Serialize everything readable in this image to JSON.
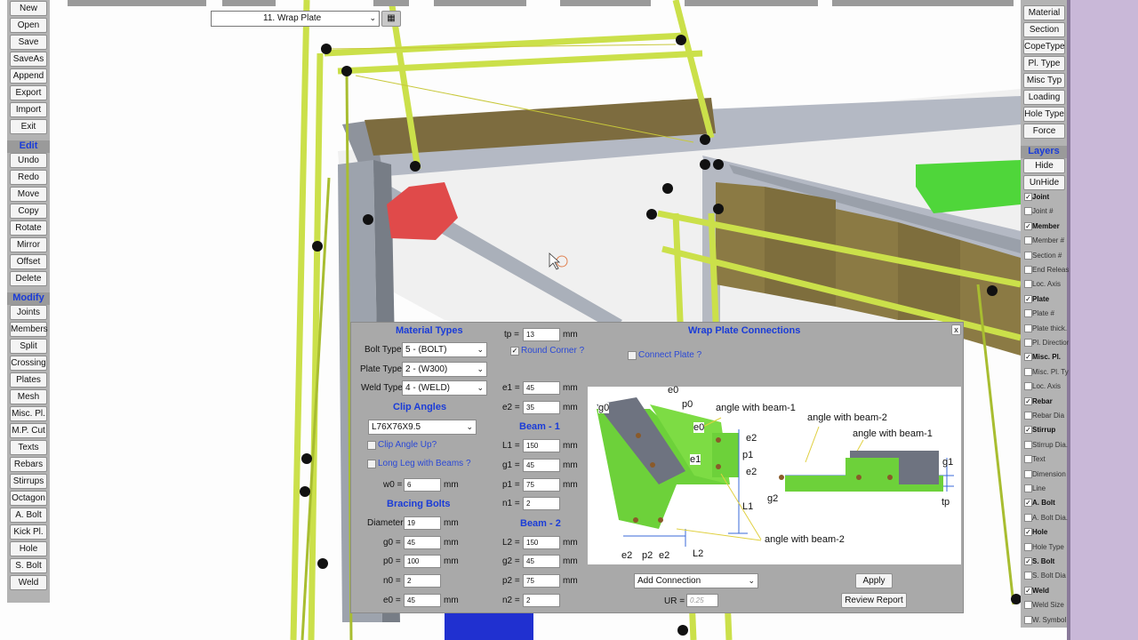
{
  "top": {
    "connection_select": "11. Wrap Plate"
  },
  "file_menu": [
    "New",
    "Open",
    "Save",
    "SaveAs",
    "Append",
    "Export",
    "Import",
    "Exit"
  ],
  "edit": {
    "title": "Edit",
    "items": [
      "Undo",
      "Redo",
      "Move",
      "Copy",
      "Rotate",
      "Mirror",
      "Offset",
      "Delete"
    ]
  },
  "modify": {
    "title": "Modify",
    "items": [
      "Joints",
      "Members",
      "Split",
      "Crossing",
      "Plates",
      "Mesh",
      "Misc. Pl.",
      "M.P. Cut",
      "Texts",
      "Rebars",
      "Stirrups",
      "Octagon",
      "A. Bolt",
      "Kick Pl.",
      "Hole",
      "S. Bolt",
      "Weld"
    ]
  },
  "right_menu": [
    "Material",
    "Section",
    "CopeType",
    "Pl. Type",
    "Misc Typ",
    "Loading",
    "Hole Type",
    "Force"
  ],
  "layers": {
    "title": "Layers",
    "hide": "Hide",
    "unhide": "UnHide",
    "items": [
      {
        "label": "Joint",
        "checked": true
      },
      {
        "label": "Joint #",
        "checked": false
      },
      {
        "label": "Member",
        "checked": true
      },
      {
        "label": "Member #",
        "checked": false
      },
      {
        "label": "Section #",
        "checked": false
      },
      {
        "label": "End Release",
        "checked": false
      },
      {
        "label": "Loc. Axis",
        "checked": false
      },
      {
        "label": "Plate",
        "checked": true
      },
      {
        "label": "Plate #",
        "checked": false
      },
      {
        "label": "Plate thick.",
        "checked": false
      },
      {
        "label": "Pl. Direction",
        "checked": false
      },
      {
        "label": "Misc. Pl.",
        "checked": true
      },
      {
        "label": "Misc. Pl. Type",
        "checked": false
      },
      {
        "label": "Loc. Axis",
        "checked": false
      },
      {
        "label": "Rebar",
        "checked": true
      },
      {
        "label": "Rebar Dia",
        "checked": false
      },
      {
        "label": "Stirrup",
        "checked": true
      },
      {
        "label": "Stirrup Dia.",
        "checked": false
      },
      {
        "label": "Text",
        "checked": false
      },
      {
        "label": "Dimension",
        "checked": false
      },
      {
        "label": "Line",
        "checked": false
      },
      {
        "label": "A. Bolt",
        "checked": true
      },
      {
        "label": "A. Bolt Dia.",
        "checked": false
      },
      {
        "label": "Hole",
        "checked": true
      },
      {
        "label": "Hole Type",
        "checked": false
      },
      {
        "label": "S. Bolt",
        "checked": true
      },
      {
        "label": "S. Bolt Dia",
        "checked": false
      },
      {
        "label": "Weld",
        "checked": true
      },
      {
        "label": "Weld Size",
        "checked": false
      },
      {
        "label": "W. Symbol",
        "checked": false
      }
    ]
  },
  "dialog": {
    "title": "Wrap Plate Connections",
    "close": "x",
    "material_types": "Material Types",
    "bolt_type_label": "Bolt Type",
    "bolt_type": "5 - (BOLT)",
    "plate_type_label": "Plate Type",
    "plate_type": "2 - (W300)",
    "weld_type_label": "Weld Type",
    "weld_type": "4 - (WELD)",
    "clip_angles": "Clip Angles",
    "clip_section": "L76X76X9.5",
    "clip_up": "Clip Angle Up?",
    "long_leg": "Long Leg with Beams ?",
    "w0_label": "w0 =",
    "w0": "6",
    "bracing_bolts": "Bracing Bolts",
    "diameter_label": "Diameter",
    "diameter": "19",
    "g0_label": "g0 =",
    "g0": "45",
    "p0_label": "p0 =",
    "p0": "100",
    "n0_label": "n0 =",
    "n0": "2",
    "e0_label": "e0 =",
    "e0": "45",
    "tp_label": "tp =",
    "tp": "13",
    "round_corner": "Round Corner ?",
    "connect_plate": "Connect Plate ?",
    "e1_label": "e1 =",
    "e1": "45",
    "e2_label": "e2 =",
    "e2": "35",
    "beam1": "Beam - 1",
    "L1_label": "L1 =",
    "L1": "150",
    "g1_label": "g1 =",
    "g1": "45",
    "p1_label": "p1 =",
    "p1": "75",
    "n1_label": "n1 =",
    "n1": "2",
    "beam2": "Beam - 2",
    "L2_label": "L2 =",
    "L2": "150",
    "g2_label": "g2 =",
    "g2": "45",
    "p2_label": "p2 =",
    "p2": "75",
    "n2_label": "n2 =",
    "n2": "2",
    "unit": "mm",
    "add_connection": "Add Connection",
    "apply": "Apply",
    "ur_label": "UR =",
    "ur": "0.25",
    "review": "Review Report",
    "diagram": {
      "g0": "g0",
      "e0": "e0",
      "p0": "p0",
      "e0b": "e0",
      "e1": "e1",
      "e2a": "e2",
      "p1": "p1",
      "e2b": "e2",
      "L1": "L1",
      "e2c": "e2",
      "p2": "p2",
      "e2d": "e2",
      "L2": "L2",
      "ab1": "angle with beam-1",
      "ab2": "angle with beam-2",
      "ab1b": "angle with beam-1",
      "ab2b": "angle with beam-2",
      "g1": "g1",
      "g2": "g2",
      "tp": "tp"
    }
  }
}
